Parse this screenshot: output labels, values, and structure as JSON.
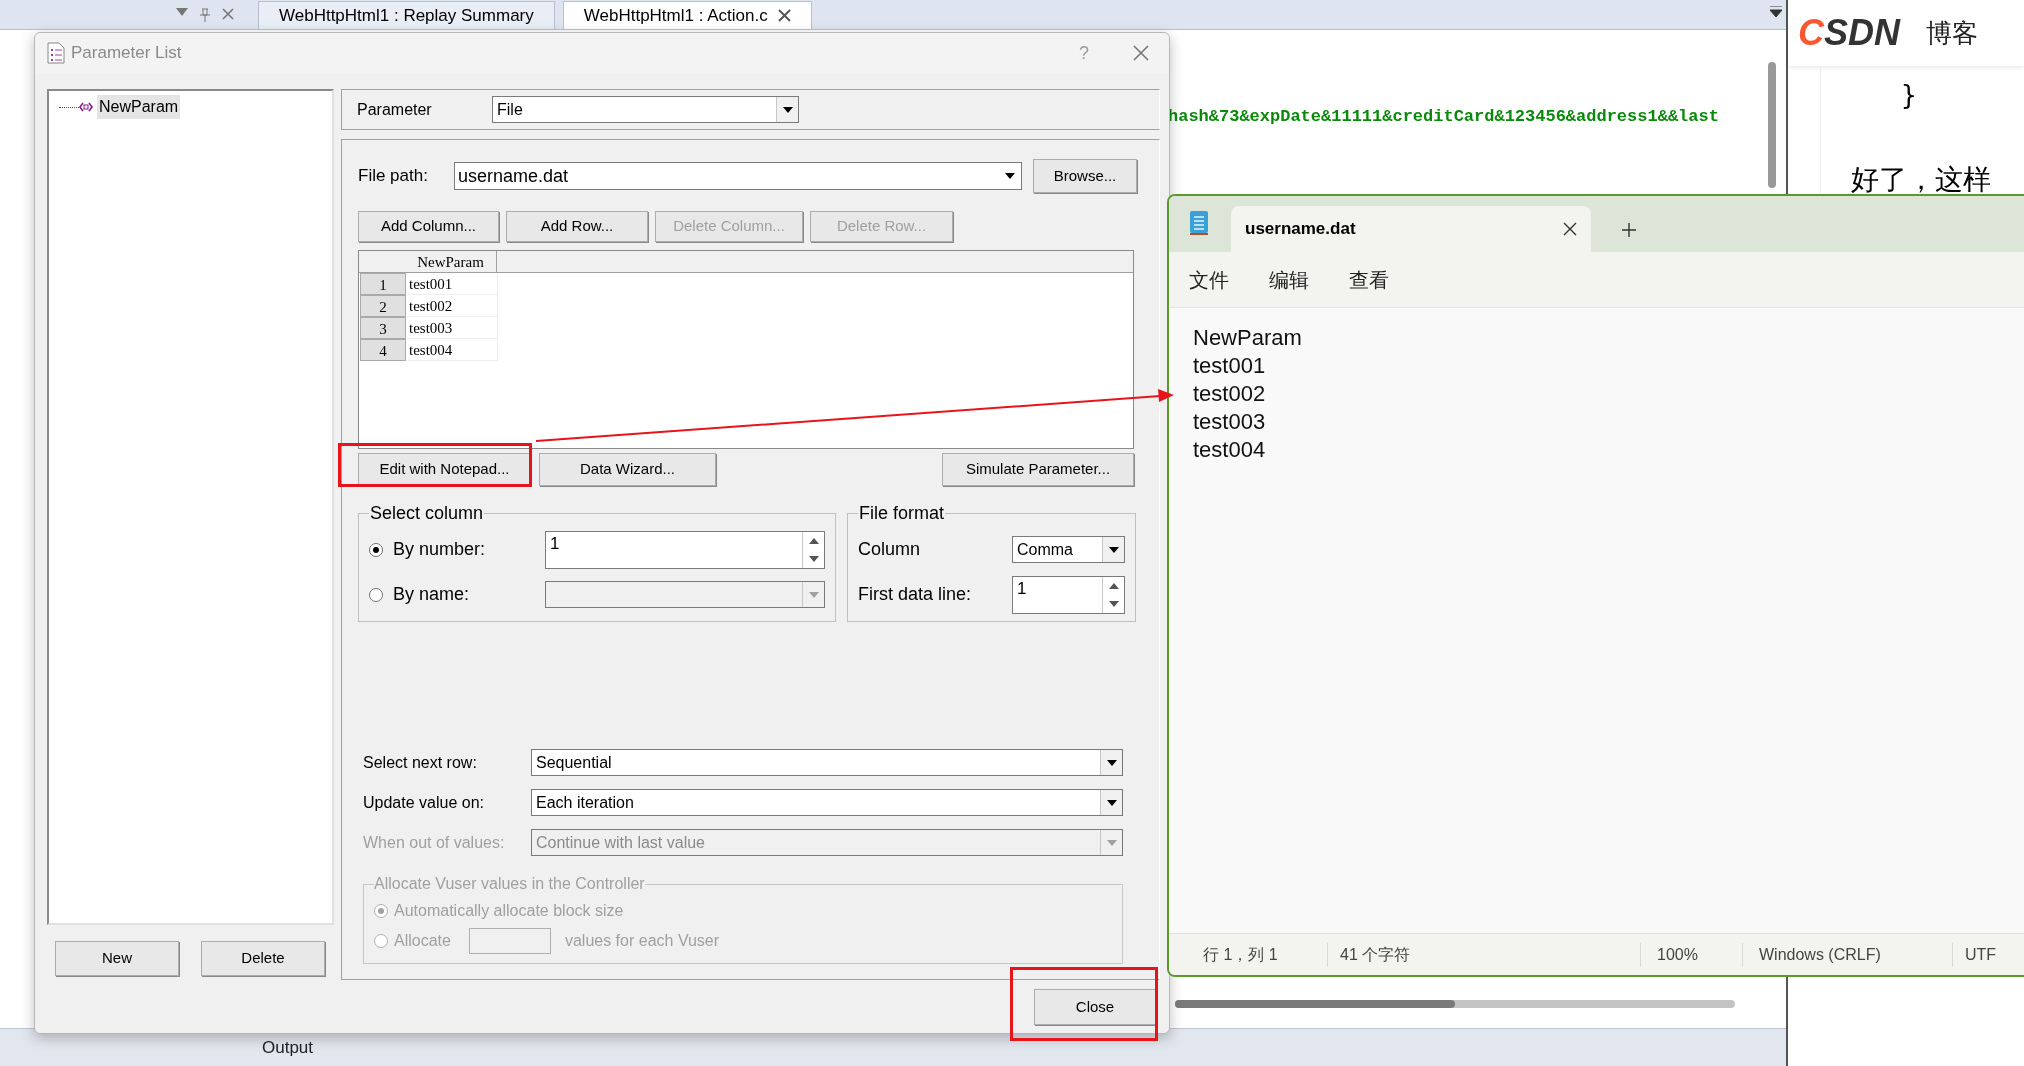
{
  "ide": {
    "tabs": [
      {
        "label": "WebHttpHtml1 : Replay Summary",
        "selected": false
      },
      {
        "label": "WebHttpHtml1 : Action.c",
        "selected": true
      }
    ],
    "code_line": "hash&73&expDate&11111&creditCard&123456&address1&&last",
    "output_title": "Output"
  },
  "browser": {
    "logo": "CSDN",
    "nav": "博客",
    "code": "}",
    "text": "好了，这样"
  },
  "dialog": {
    "title": "Parameter List",
    "help": "?",
    "tree": [
      {
        "label": "NewParam",
        "selected": true
      }
    ],
    "left_buttons": [
      "New",
      "Delete"
    ],
    "parameter": {
      "label": "Parameter",
      "value": "File"
    },
    "file_path": {
      "label": "File path:",
      "value": "username.dat",
      "button": "Browse..."
    },
    "table_actions": [
      {
        "label": "Add Column...",
        "disabled": false
      },
      {
        "label": "Add Row...",
        "disabled": false
      },
      {
        "label": "Delete Column...",
        "disabled": true
      },
      {
        "label": "Delete Row...",
        "disabled": true
      }
    ],
    "table": {
      "columns": [
        "NewParam"
      ],
      "rows": [
        {
          "index": "1",
          "values": [
            "test001"
          ]
        },
        {
          "index": "2",
          "values": [
            "test002"
          ]
        },
        {
          "index": "3",
          "values": [
            "test003"
          ]
        },
        {
          "index": "4",
          "values": [
            "test004"
          ]
        }
      ]
    },
    "actions": [
      "Edit with Notepad...",
      "Data Wizard...",
      "Simulate Parameter..."
    ],
    "select_column": {
      "title": "Select column",
      "options": [
        {
          "label": "By number:",
          "selected": true,
          "kind": "spin",
          "value": "1",
          "disabled": false
        },
        {
          "label": "By name:",
          "selected": false,
          "kind": "combo",
          "disabled": true
        }
      ]
    },
    "file_format": {
      "title": "File format",
      "column": {
        "label": "Column",
        "value": "Comma"
      },
      "first_data_line": {
        "label": "First data line:",
        "value": "1"
      }
    },
    "settings": [
      {
        "label": "Select next row:",
        "value": "Sequential",
        "disabled": false
      },
      {
        "label": "Update value on:",
        "value": "Each iteration",
        "disabled": false
      },
      {
        "label": "When out of values:",
        "value": "Continue with last value",
        "disabled": true
      }
    ],
    "allocate": {
      "title": "Allocate Vuser values in the Controller",
      "disabled": true,
      "options": [
        {
          "label": "Automatically allocate block size",
          "selected": true,
          "kind": "plain"
        },
        {
          "label": "Allocate",
          "suffix": "values for each Vuser",
          "selected": false,
          "kind": "field"
        }
      ]
    },
    "close": "Close"
  },
  "notepad": {
    "tab": "username.dat",
    "menu": [
      "文件",
      "编辑",
      "查看"
    ],
    "lines": [
      "NewParam",
      "test001",
      "test002",
      "test003",
      "test004"
    ],
    "status": [
      "行 1，列 1",
      "41 个字符",
      "100%",
      "Windows (CRLF)",
      "UTF"
    ]
  }
}
